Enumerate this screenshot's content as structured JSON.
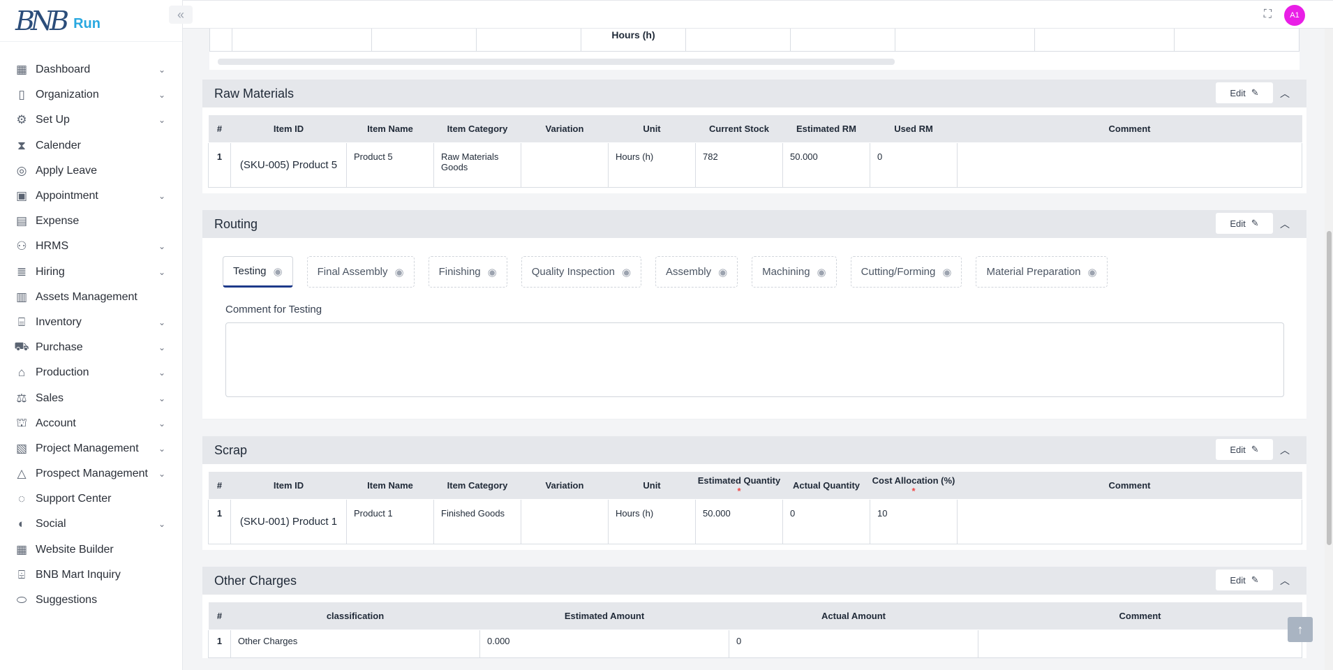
{
  "brand": {
    "logo_mark": "BNB",
    "logo_text": "Run"
  },
  "sidebar": {
    "items": [
      {
        "label": "Dashboard",
        "icon": "dashboard-icon",
        "glyph": "▦",
        "chevron": true
      },
      {
        "label": "Organization",
        "icon": "document-icon",
        "glyph": "▯",
        "chevron": true
      },
      {
        "label": "Set Up",
        "icon": "settings-file-icon",
        "glyph": "⚙",
        "chevron": true
      },
      {
        "label": "Calender",
        "icon": "hourglass-icon",
        "glyph": "⧗",
        "chevron": false
      },
      {
        "label": "Apply Leave",
        "icon": "lifebuoy-icon",
        "glyph": "◎",
        "chevron": false
      },
      {
        "label": "Appointment",
        "icon": "calendar-check-icon",
        "glyph": "▣",
        "chevron": true
      },
      {
        "label": "Expense",
        "icon": "money-icon",
        "glyph": "▤",
        "chevron": false
      },
      {
        "label": "HRMS",
        "icon": "users-icon",
        "glyph": "⚇",
        "chevron": true
      },
      {
        "label": "Hiring",
        "icon": "hiring-icon",
        "glyph": "≣",
        "chevron": true
      },
      {
        "label": "Assets Management",
        "icon": "assets-icon",
        "glyph": "▥",
        "chevron": false
      },
      {
        "label": "Inventory",
        "icon": "inventory-icon",
        "glyph": "⌸",
        "chevron": true
      },
      {
        "label": "Purchase",
        "icon": "cart-icon",
        "glyph": "⛟",
        "chevron": true
      },
      {
        "label": "Production",
        "icon": "factory-icon",
        "glyph": "⌂",
        "chevron": true
      },
      {
        "label": "Sales",
        "icon": "sales-icon",
        "glyph": "⚖",
        "chevron": true
      },
      {
        "label": "Account",
        "icon": "bank-icon",
        "glyph": "⛫",
        "chevron": true
      },
      {
        "label": "Project Management",
        "icon": "project-icon",
        "glyph": "▧",
        "chevron": true
      },
      {
        "label": "Prospect Management",
        "icon": "drive-icon",
        "glyph": "△",
        "chevron": true
      },
      {
        "label": "Support Center",
        "icon": "support-icon",
        "glyph": "◌",
        "chevron": false
      },
      {
        "label": "Social",
        "icon": "social-icon",
        "glyph": "◐",
        "chevron": true
      },
      {
        "label": "Website Builder",
        "icon": "layout-icon",
        "glyph": "▦",
        "chevron": false
      },
      {
        "label": "BNB Mart Inquiry",
        "icon": "store-icon",
        "glyph": "⌹",
        "chevron": false
      },
      {
        "label": "Suggestions",
        "icon": "toggle-icon",
        "glyph": "⬭",
        "chevron": false
      }
    ]
  },
  "topbar": {
    "avatar_initials": "A1"
  },
  "top_partial": {
    "unit_text": "Hours (h)"
  },
  "raw_materials": {
    "title": "Raw Materials",
    "edit_label": "Edit",
    "columns": [
      "#",
      "Item ID",
      "Item Name",
      "Item Category",
      "Variation",
      "Unit",
      "Current Stock",
      "Estimated RM",
      "Used RM",
      "Comment"
    ],
    "rows": [
      {
        "num": "1",
        "item_id": "(SKU-005) Product 5",
        "item_name": "Product 5",
        "category": "Raw Materials Goods",
        "variation": "",
        "unit": "Hours (h)",
        "current_stock": "782",
        "estimated_rm": "50.000",
        "used_rm": "0",
        "comment": ""
      }
    ]
  },
  "routing": {
    "title": "Routing",
    "edit_label": "Edit",
    "tabs": [
      "Testing",
      "Final Assembly",
      "Finishing",
      "Quality Inspection",
      "Assembly",
      "Machining",
      "Cutting/Forming",
      "Material Preparation"
    ],
    "active_tab": "Testing",
    "comment_label": "Comment for Testing",
    "comment_value": ""
  },
  "scrap": {
    "title": "Scrap",
    "edit_label": "Edit",
    "columns": [
      "#",
      "Item ID",
      "Item Name",
      "Item Category",
      "Variation",
      "Unit",
      "Estimated Quantity",
      "Actual Quantity",
      "Cost Allocation (%)",
      "Comment"
    ],
    "required_mark": "*",
    "rows": [
      {
        "num": "1",
        "item_id": "(SKU-001) Product 1",
        "item_name": "Product 1",
        "category": "Finished Goods",
        "variation": "",
        "unit": "Hours (h)",
        "estimated_quantity": "50.000",
        "actual_quantity": "0",
        "cost_allocation": "10",
        "comment": ""
      }
    ]
  },
  "other_charges": {
    "title": "Other Charges",
    "edit_label": "Edit",
    "columns": [
      "#",
      "classification",
      "Estimated Amount",
      "Actual Amount",
      "Comment"
    ],
    "rows": [
      {
        "num": "1",
        "classification": "Other Charges",
        "estimated_amount": "0.000",
        "actual_amount": "0",
        "comment": ""
      }
    ]
  }
}
